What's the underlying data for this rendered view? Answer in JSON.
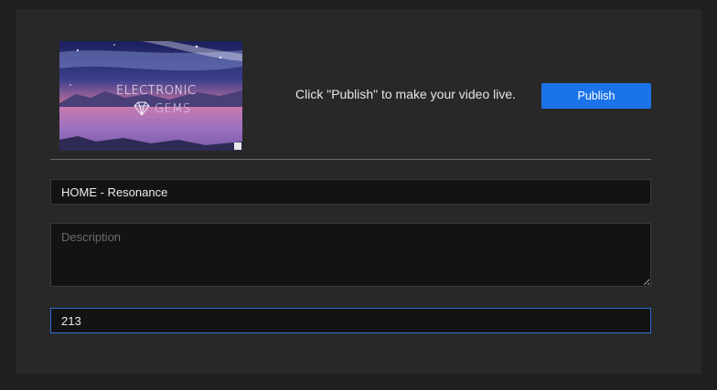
{
  "thumbnail": {
    "title_text": "ELECTRONIC",
    "subtitle_text": "GEMS"
  },
  "publish": {
    "message": "Click \"Publish\" to make your video live.",
    "button_label": "Publish",
    "button_color": "#1a73e8"
  },
  "form": {
    "title_value": "HOME - Resonance",
    "description_value": "",
    "description_placeholder": "Description",
    "tags_value": "213"
  }
}
